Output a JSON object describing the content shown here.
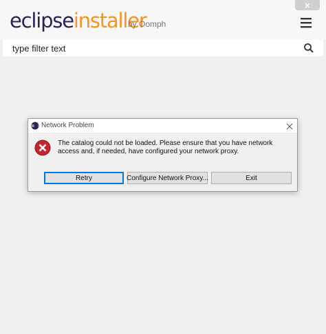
{
  "header": {
    "logo_part1": "eclipse",
    "logo_part2": "installer",
    "byline": "by Oomph",
    "close_icon": "close-icon",
    "menu_icon": "hamburger-menu-icon"
  },
  "search": {
    "placeholder": "type filter text",
    "value": "",
    "icon": "search-icon"
  },
  "dialog": {
    "title": "Network Problem",
    "message": "The catalog could not be loaded. Please ensure that you have network access and, if needed, have configured your network proxy.",
    "icon": "error-icon",
    "buttons": {
      "retry": "Retry",
      "configure_proxy": "Configure Network Proxy...",
      "exit": "Exit"
    }
  },
  "colors": {
    "logo_dark": "#2c2255",
    "logo_orange": "#f7941e",
    "error_red": "#c4262e",
    "default_button_border": "#0078d7"
  }
}
